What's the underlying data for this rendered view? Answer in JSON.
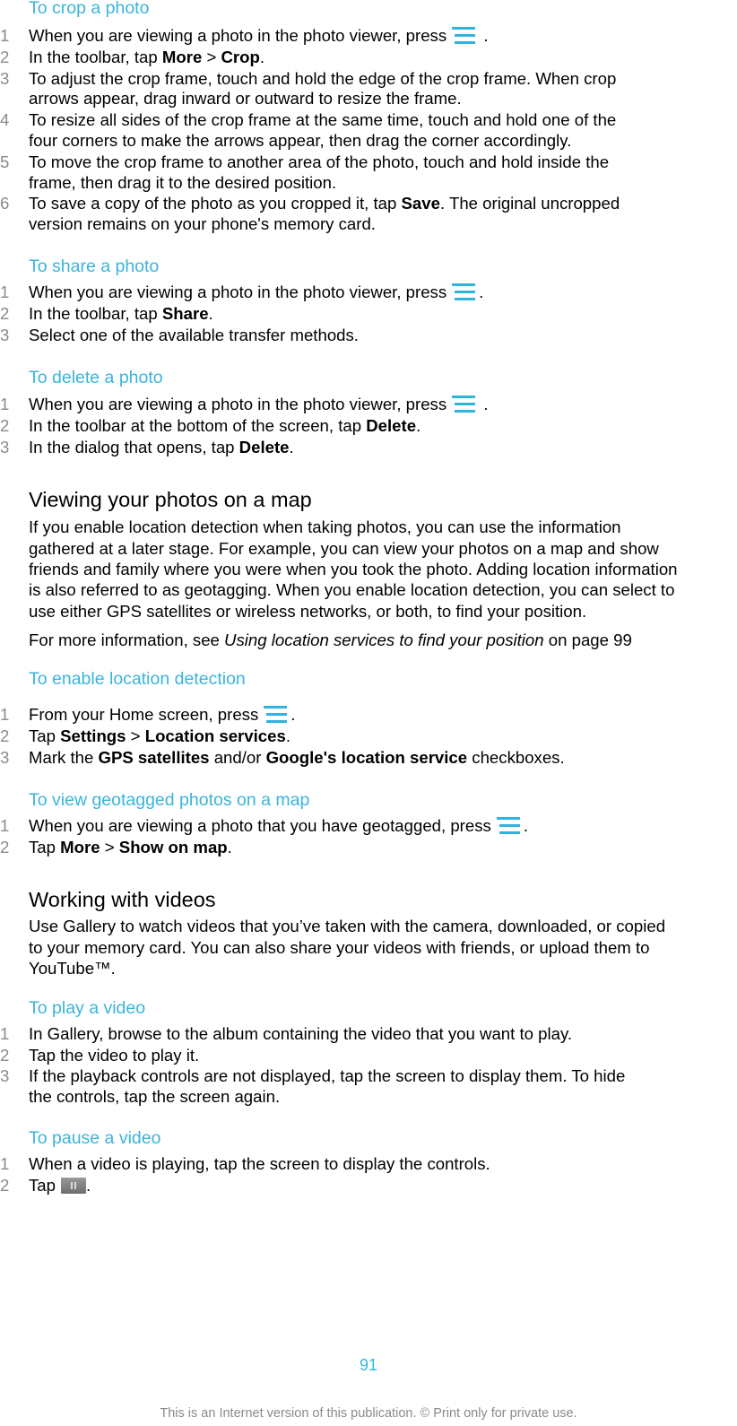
{
  "sections": {
    "crop": {
      "heading": "To crop a photo",
      "steps": [
        {
          "num": "1",
          "a": "When you are viewing a photo in the photo viewer, press",
          "b": " ."
        },
        {
          "num": "2",
          "a": "In the toolbar, tap ",
          "b1": "More",
          "sep": " > ",
          "b2": "Crop",
          "end": "."
        },
        {
          "num": "3",
          "l1": "To adjust the crop frame, touch and hold the edge of the crop frame. When crop",
          "l2": "arrows appear, drag inward or outward to resize the frame."
        },
        {
          "num": "4",
          "l1": "To resize all sides of the crop frame at the same time, touch and hold one of the",
          "l2": "four corners to make the arrows appear, then drag the corner accordingly."
        },
        {
          "num": "5",
          "l1": "To move the crop frame to another area of the photo, touch and hold inside the",
          "l2": "frame, then drag it to the desired position."
        },
        {
          "num": "6",
          "a": "To save a copy of the photo as you cropped it, tap ",
          "b1": "Save",
          "end": ". The original uncropped",
          "l2": "version remains on your phone's memory card."
        }
      ]
    },
    "share": {
      "heading": "To share a photo",
      "steps": [
        {
          "num": "1",
          "a": "When you are viewing a photo in the photo viewer, press",
          "b": "."
        },
        {
          "num": "2",
          "a": "In the toolbar, tap ",
          "b1": "Share",
          "end": "."
        },
        {
          "num": "3",
          "a": "Select one of the available transfer methods."
        }
      ]
    },
    "delete": {
      "heading": "To delete a photo",
      "steps": [
        {
          "num": "1",
          "a": "When you are viewing a photo in the photo viewer, press",
          "b": " ."
        },
        {
          "num": "2",
          "a": "In the toolbar at the bottom of the screen, tap ",
          "b1": "Delete",
          "end": "."
        },
        {
          "num": "3",
          "a": "In the dialog that opens, tap ",
          "b1": "Delete",
          "end": "."
        }
      ]
    },
    "map": {
      "heading": "Viewing your photos on a map",
      "para_lines": [
        "If you enable location detection when taking photos, you can use the information",
        "gathered at a later stage. For example, you can view your photos on a map and show",
        "friends and family where you were when you took the photo. Adding location information",
        "is also referred to as geotagging. When you enable location detection, you can select to",
        "use either GPS satellites or wireless networks, or both, to find your position."
      ],
      "more_prefix": "For more information, see ",
      "more_link": "Using location services to find your position",
      "more_suffix": " on page 99"
    },
    "enable_location": {
      "heading": "To enable location detection",
      "steps": [
        {
          "num": "1",
          "a": "From your Home screen, press",
          "b": "."
        },
        {
          "num": "2",
          "a": "Tap ",
          "b1": "Settings",
          "sep": " > ",
          "b2": "Location services",
          "end": "."
        },
        {
          "num": "3",
          "a": "Mark the ",
          "b1": "GPS satellites",
          "mid": " and/or ",
          "b2": "Google's location service",
          "end": " checkboxes."
        }
      ]
    },
    "geotagged": {
      "heading": "To view geotagged photos on a map",
      "steps": [
        {
          "num": "1",
          "a": "When you are viewing a photo that you have geotagged, press",
          "b": "."
        },
        {
          "num": "2",
          "a": "Tap ",
          "b1": "More",
          "sep": " > ",
          "b2": "Show on map",
          "end": "."
        }
      ]
    },
    "videos": {
      "heading": "Working with videos",
      "para_lines": [
        "Use Gallery to watch videos that you’ve taken with the camera, downloaded, or copied",
        "to your memory card. You can also share your videos with friends, or upload them to",
        "YouTube™."
      ]
    },
    "play": {
      "heading": "To play a video",
      "steps": [
        {
          "num": "1",
          "a": "In Gallery, browse to the album containing the video that you want to play."
        },
        {
          "num": "2",
          "a": "Tap the video to play it."
        },
        {
          "num": "3",
          "l1": "If the playback controls are not displayed, tap the screen to display them. To hide",
          "l2": "the controls, tap the screen again."
        }
      ]
    },
    "pause": {
      "heading": "To pause a video",
      "steps": [
        {
          "num": "1",
          "a": "When a video is playing, tap the screen to display the controls."
        },
        {
          "num": "2",
          "a": "Tap",
          "b": "."
        }
      ]
    }
  },
  "icons": {
    "menu": "menu-icon",
    "pause": "pause-icon"
  },
  "colors": {
    "heading_accent": "#3ab4dc",
    "menu_icon": "#2fb4e0",
    "step_number": "#8a8a8a"
  },
  "page_number": "91",
  "footer": "This is an Internet version of this publication. © Print only for private use."
}
